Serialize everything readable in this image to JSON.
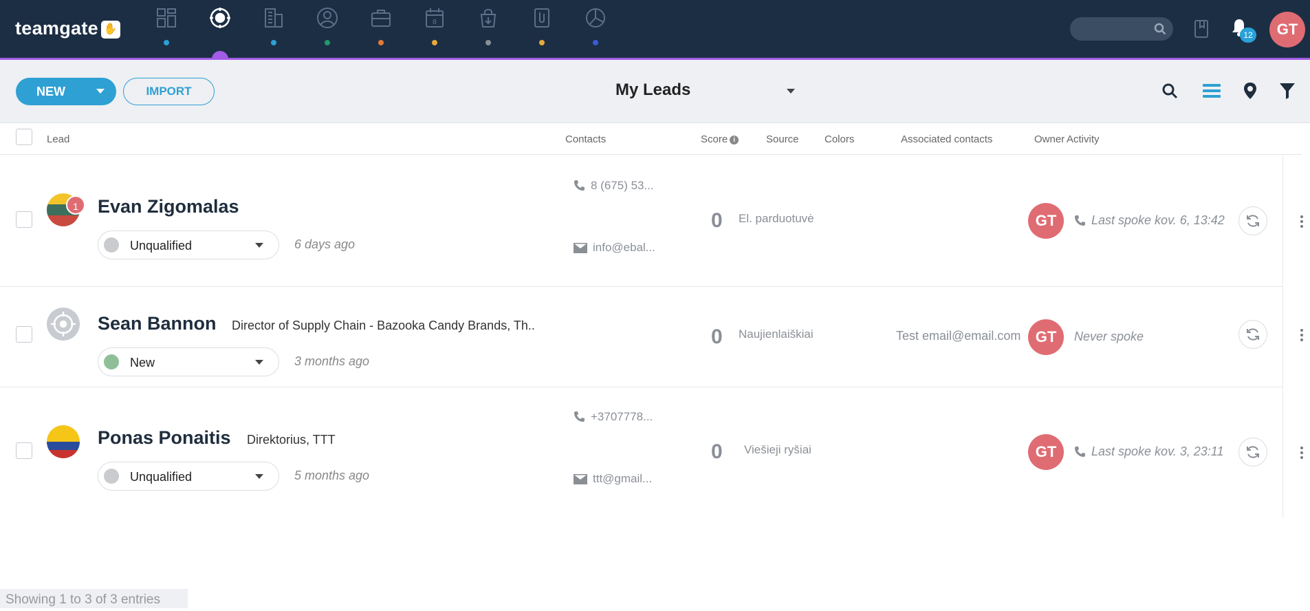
{
  "app": {
    "logo_text": "teamgate",
    "logo_badge": "✋",
    "notifications_count": "12",
    "user_initials": "GT",
    "accent_color": "#a35ce6",
    "brand_color": "#1c2e44"
  },
  "nav": [
    {
      "name": "dashboard-icon",
      "dot": "#2ea0d3"
    },
    {
      "name": "leads-icon",
      "dot": "",
      "active": true
    },
    {
      "name": "companies-icon",
      "dot": "#2ea0d3"
    },
    {
      "name": "people-icon",
      "dot": "#1f9a6b"
    },
    {
      "name": "deals-icon",
      "dot": "#e07b39"
    },
    {
      "name": "calendar-icon",
      "dot": "#e6a93a"
    },
    {
      "name": "orders-icon",
      "dot": "#8a8f96"
    },
    {
      "name": "files-icon",
      "dot": "#e6a93a"
    },
    {
      "name": "reports-icon",
      "dot": "#3b5bd6"
    }
  ],
  "toolbar": {
    "new_label": "NEW",
    "import_label": "IMPORT",
    "view_title": "My Leads"
  },
  "columns": {
    "lead": "Lead",
    "contacts": "Contacts",
    "score": "Score",
    "source": "Source",
    "colors": "Colors",
    "associated": "Associated contacts",
    "owner": "Owner",
    "activity": "Activity"
  },
  "rows": [
    {
      "name": "Evan Zigomalas",
      "title": "",
      "badge": "1",
      "status": "Unqualified",
      "status_color": "#c9cbcf",
      "ago": "6 days ago",
      "phone": "8 (675) 53...",
      "email": "info@ebal...",
      "score": "0",
      "source": "El. parduotuvė",
      "associated": "",
      "owner": "GT",
      "activity": "Last spoke kov. 6, 13:42"
    },
    {
      "name": "Sean Bannon",
      "title": "Director of Supply Chain - Bazooka Candy Brands, Th..",
      "badge": "",
      "status": "New",
      "status_color": "#8fbf98",
      "ago": "3 months ago",
      "phone": "",
      "email": "",
      "score": "0",
      "source": "Naujienlaiškiai",
      "associated": "Test email@email.com",
      "owner": "GT",
      "activity": "Never spoke"
    },
    {
      "name": "Ponas Ponaitis",
      "title": "Direktorius, TTT",
      "badge": "",
      "status": "Unqualified",
      "status_color": "#c9cbcf",
      "ago": "5 months ago",
      "phone": "+3707778...",
      "email": "ttt@gmail...",
      "score": "0",
      "source": "Viešieji ryšiai",
      "associated": "",
      "owner": "GT",
      "activity": "Last spoke kov. 3, 23:11"
    }
  ],
  "footer": {
    "info": "Showing 1 to 3 of 3 entries"
  }
}
